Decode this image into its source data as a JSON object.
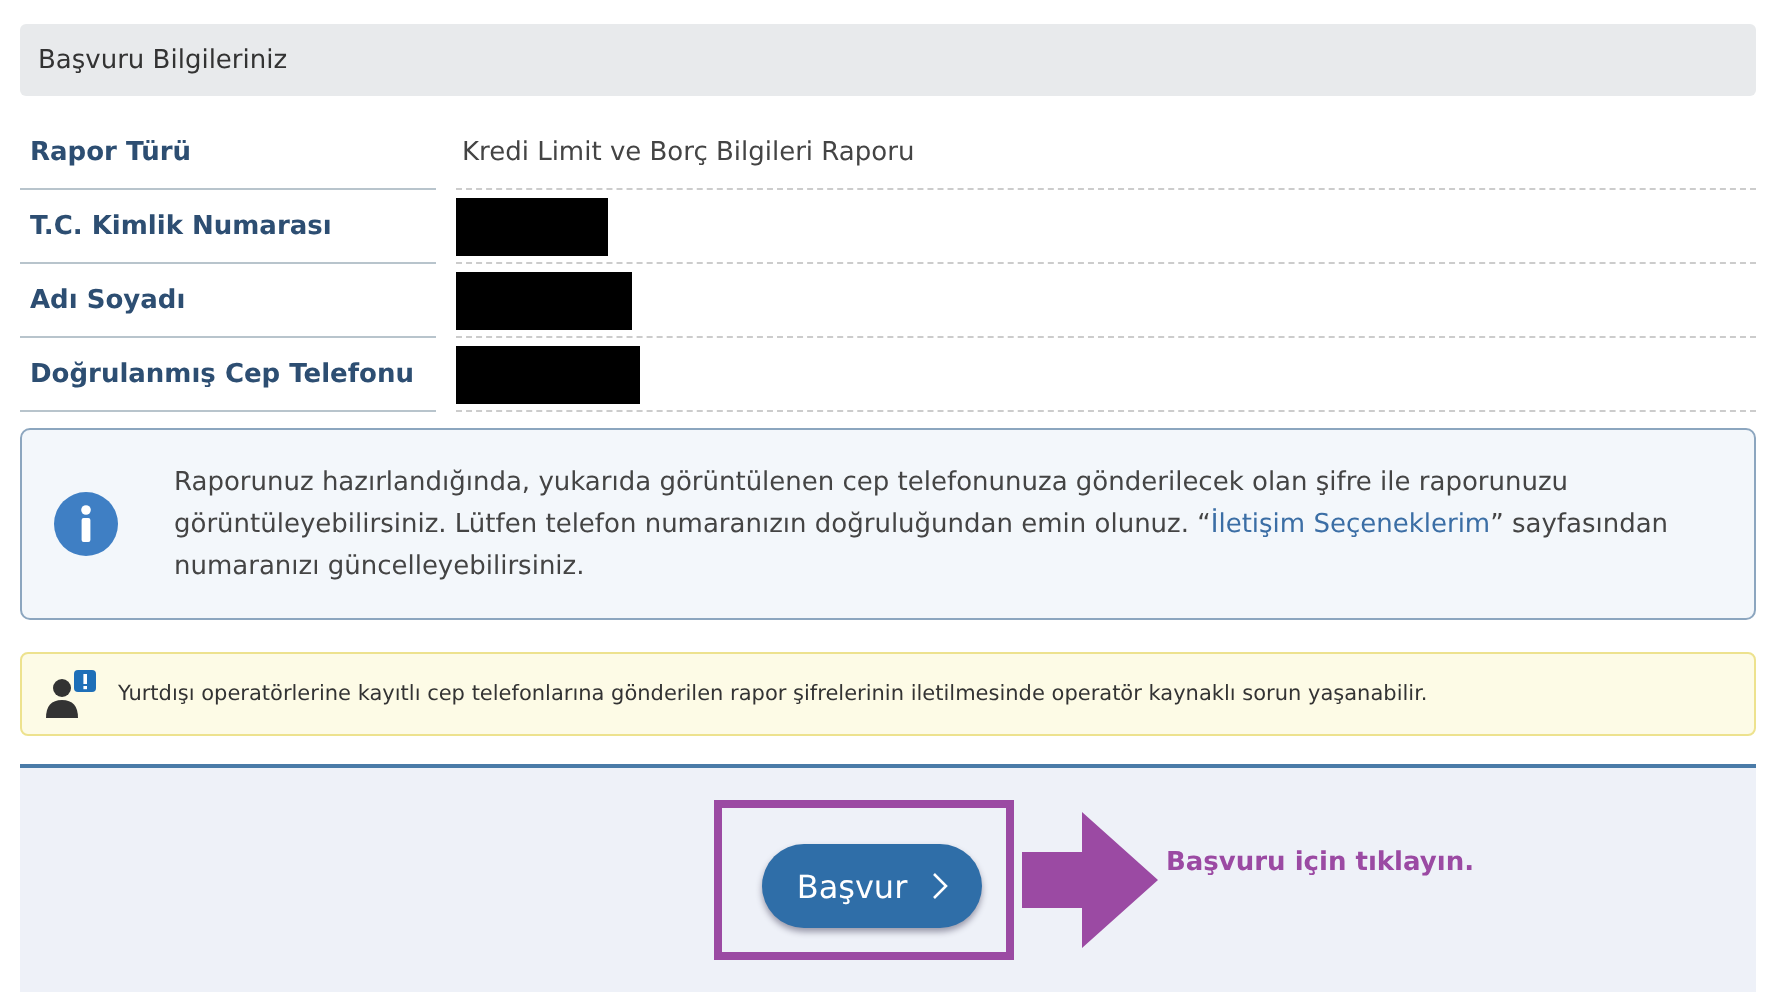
{
  "panel": {
    "title": "Başvuru Bilgileriniz"
  },
  "rows": [
    {
      "label": "Rapor Türü",
      "value": "Kredi Limit ve Borç Bilgileri Raporu",
      "redacted": false
    },
    {
      "label": "T.C. Kimlik Numarası",
      "redacted": true
    },
    {
      "label": "Adı Soyadı",
      "redacted": true
    },
    {
      "label": "Doğrulanmış Cep Telefonu",
      "redacted": true
    }
  ],
  "info": {
    "text_before": "Raporunuz hazırlandığında, yukarıda görüntülenen cep telefonunuza gönderilecek olan şifre ile raporunuzu görüntüleyebilirsiniz. Lütfen telefon numaranızın doğruluğundan emin olunuz. “",
    "link": "İletişim Seçeneklerim",
    "text_after": "” sayfasından numaranızı güncelleyebilirsiniz."
  },
  "warning": {
    "text": "Yurtdışı operatörlerine kayıtlı cep telefonlarına gönderilen rapor şifrelerinin iletilmesinde operatör kaynaklı sorun yaşanabilir."
  },
  "footer": {
    "button": "Başvur",
    "annotation": "Başvuru için tıklayın."
  }
}
